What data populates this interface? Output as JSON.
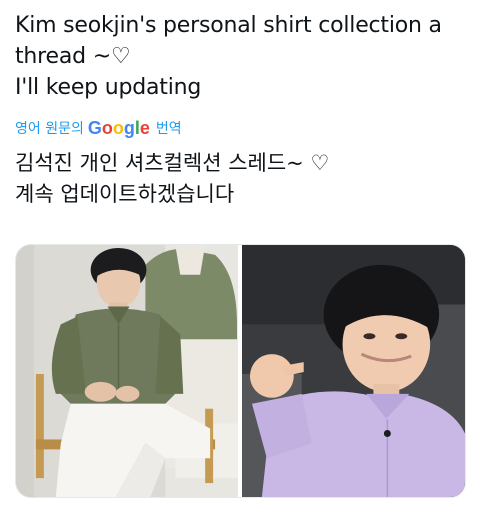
{
  "tweet": {
    "text_lines": [
      "Kim seokjin's personal shirt collection a",
      "thread ~♡",
      "I'll keep updating"
    ],
    "translate": {
      "prefix": "영어 원문의",
      "logo_letters": [
        "G",
        "o",
        "o",
        "g",
        "l",
        "e"
      ],
      "suffix": "번역"
    },
    "translated_lines": [
      "김석진 개인 셔츠컬렉션 스레드~ ♡",
      "계속 업데이트하겠습니다"
    ]
  },
  "media": {
    "items": [
      {
        "subject": "photo of man in olive green shirt seated on a chair"
      },
      {
        "subject": "photo of man in lavender shirt pointing at camera"
      }
    ],
    "colors": {
      "olive_shirt": "#6f7a5c",
      "lavender_shirt": "#c9b8e6",
      "accent_link": "#1d9bf0"
    }
  }
}
